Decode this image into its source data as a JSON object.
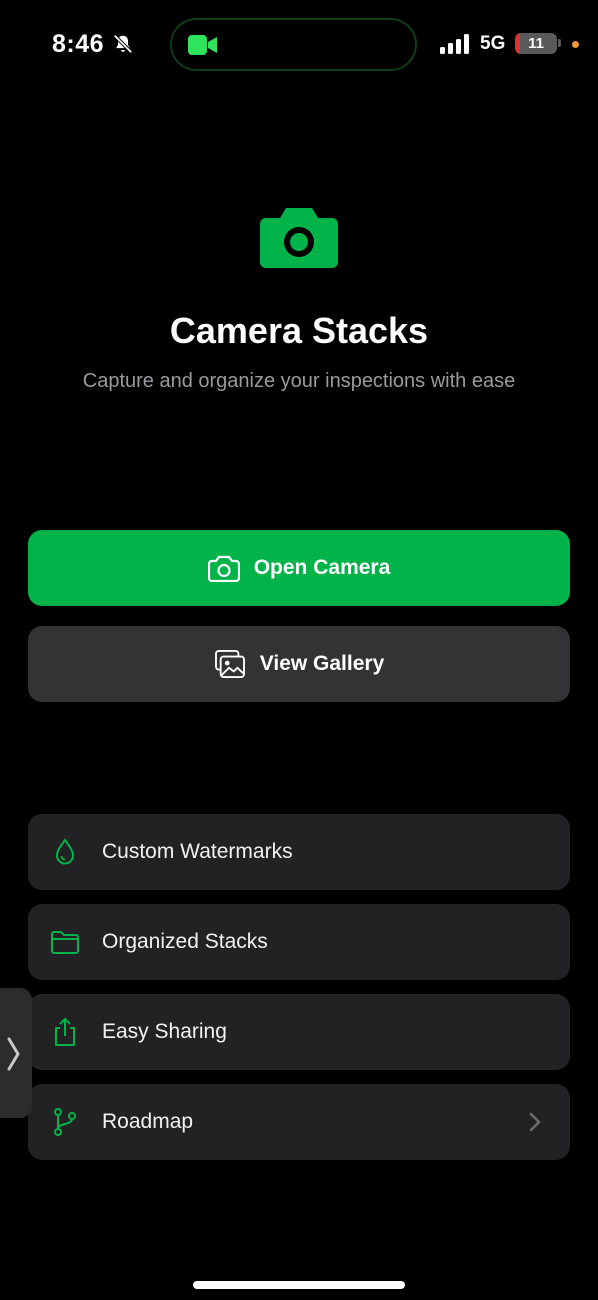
{
  "status_bar": {
    "time": "8:46",
    "network": "5G",
    "battery": "11",
    "battery_level": 0.11
  },
  "hero": {
    "title": "Camera Stacks",
    "subtitle": "Capture and organize your inspections with ease"
  },
  "actions": {
    "open_camera": "Open Camera",
    "view_gallery": "View Gallery"
  },
  "features": [
    {
      "label": "Custom Watermarks",
      "icon": "droplet-icon"
    },
    {
      "label": "Organized Stacks",
      "icon": "folder-icon"
    },
    {
      "label": "Easy Sharing",
      "icon": "share-icon"
    },
    {
      "label": "Roadmap",
      "icon": "branch-icon"
    }
  ],
  "colors": {
    "accent": "#02b34a",
    "background": "#000000",
    "card": "#222224",
    "secondary_button": "#333335"
  }
}
